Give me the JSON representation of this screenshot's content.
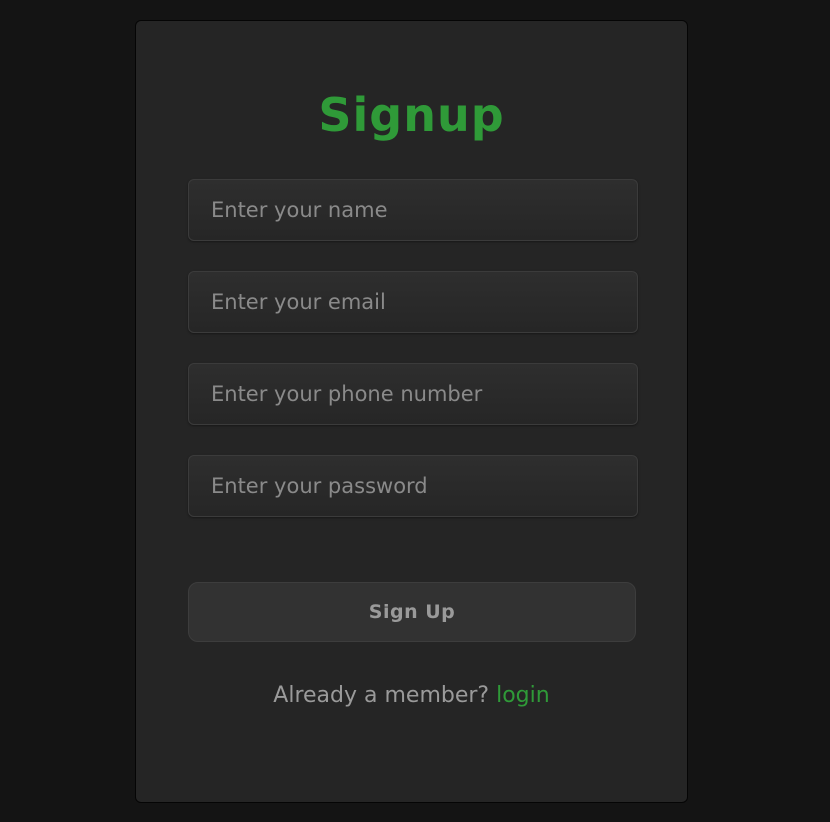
{
  "form": {
    "title": "Signup",
    "fields": [
      {
        "placeholder": "Enter your name",
        "value": ""
      },
      {
        "placeholder": "Enter your email",
        "value": ""
      },
      {
        "placeholder": "Enter your phone number",
        "value": ""
      },
      {
        "placeholder": "Enter your password",
        "value": ""
      }
    ],
    "submit_label": "Sign Up",
    "footer_text": "Already a member?",
    "login_link": "login"
  },
  "colors": {
    "background": "#141414",
    "card": "#252525",
    "accent": "#2f9a38",
    "muted_text": "#9a9a9a"
  }
}
